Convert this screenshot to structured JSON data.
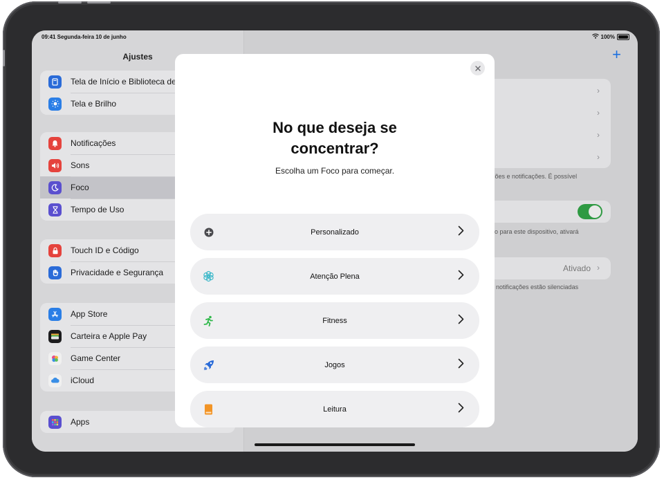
{
  "status_bar": {
    "time_date": "09:41  Segunda-feira 10 de junho",
    "battery": "100%"
  },
  "sidebar": {
    "title": "Ajustes",
    "groups": [
      [
        {
          "label": "Tela de Início e Biblioteca de Apps",
          "icon": "home-screen-icon",
          "color": "#2a6bd8"
        },
        {
          "label": "Tela e Brilho",
          "icon": "brightness-icon",
          "color": "#2a7ee6"
        }
      ],
      [
        {
          "label": "Notificações",
          "icon": "bell-icon",
          "color": "#e5433d"
        },
        {
          "label": "Sons",
          "icon": "speaker-icon",
          "color": "#e5433d"
        },
        {
          "label": "Foco",
          "icon": "moon-icon",
          "color": "#5a4fcf",
          "selected": true
        },
        {
          "label": "Tempo de Uso",
          "icon": "hourglass-icon",
          "color": "#5a4fcf"
        }
      ],
      [
        {
          "label": "Touch ID e Código",
          "icon": "lock-icon",
          "color": "#e5433d"
        },
        {
          "label": "Privacidade e Segurança",
          "icon": "hand-icon",
          "color": "#2a6bd8"
        }
      ],
      [
        {
          "label": "App Store",
          "icon": "app-store-icon",
          "color": "#2a7ee6"
        },
        {
          "label": "Carteira e Apple Pay",
          "icon": "wallet-icon",
          "color": "#1c1c1e"
        },
        {
          "label": "Game Center",
          "icon": "game-center-icon",
          "color": "#f0f0f0"
        },
        {
          "label": "iCloud",
          "icon": "cloud-icon",
          "color": "#f0f0f0"
        }
      ],
      [
        {
          "label": "Apps",
          "icon": "apps-icon",
          "color": "#5a4fcf"
        }
      ]
    ]
  },
  "detail": {
    "text1": "ções e notificações. É possível",
    "text2": "lo para este dispositivo, ativará",
    "status_value": "Ativado",
    "text3": "notificações estão silenciadas"
  },
  "modal": {
    "title_line1": "No que deseja se",
    "title_line2": "concentrar?",
    "subtitle": "Escolha um Foco para começar.",
    "options": [
      {
        "label": "Personalizado",
        "icon": "plus-circle-icon"
      },
      {
        "label": "Atenção Plena",
        "icon": "mindfulness-icon",
        "color": "#3bb8c9"
      },
      {
        "label": "Fitness",
        "icon": "running-icon",
        "color": "#2fb84a"
      },
      {
        "label": "Jogos",
        "icon": "rocket-icon",
        "color": "#2a6bd8"
      },
      {
        "label": "Leitura",
        "icon": "book-icon",
        "color": "#f29426"
      }
    ]
  }
}
